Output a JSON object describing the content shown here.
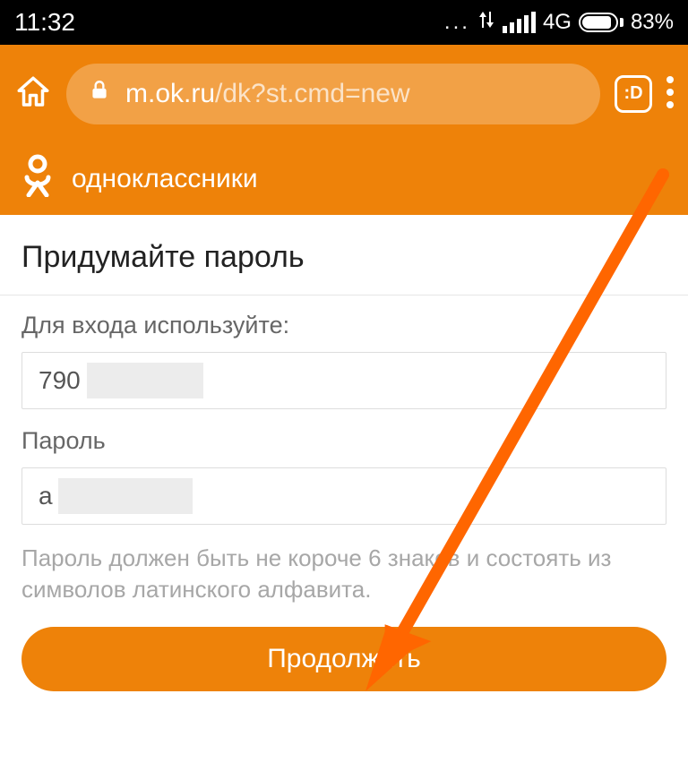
{
  "status": {
    "time": "11:32",
    "network_label": "4G",
    "battery_percent": "83%",
    "ellipsis": "..."
  },
  "browser": {
    "url_domain": "m.ok.ru",
    "url_path": "/dk?st.cmd=new",
    "tab_indicator": ":D"
  },
  "site": {
    "title": "одноклассники"
  },
  "page": {
    "title": "Придумайте пароль",
    "login_label": "Для входа используйте:",
    "login_value": "790",
    "password_label": "Пароль",
    "password_value": "a",
    "hint": "Пароль должен быть не короче 6 знаков и состоять из символов латинского алфавита.",
    "cta": "Продолжить"
  }
}
